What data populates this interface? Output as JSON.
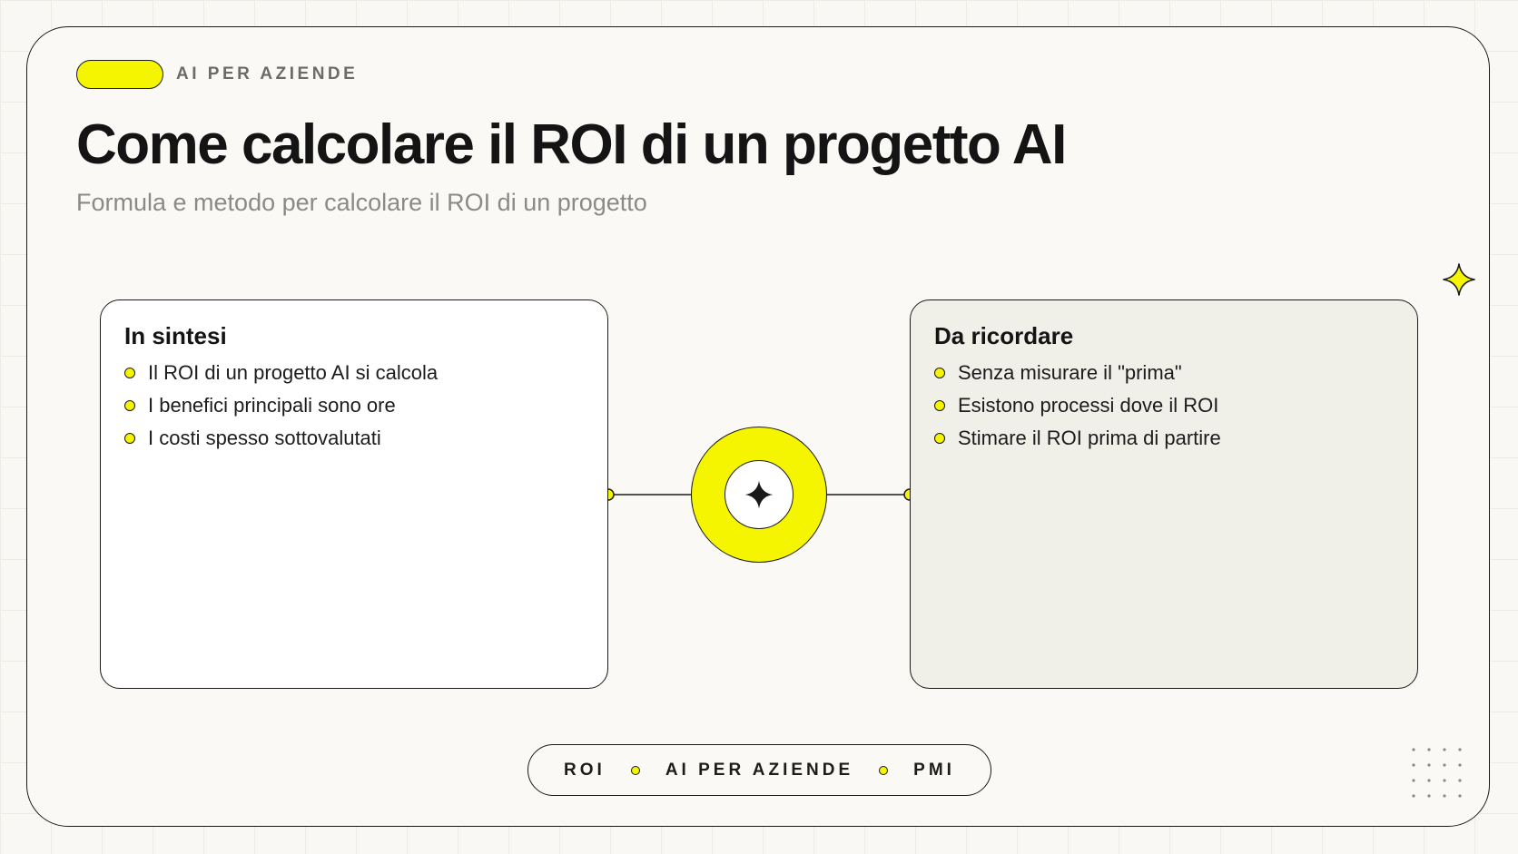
{
  "header": {
    "badge_label": "AI PER AZIENDE",
    "title": "Come calcolare il ROI di un progetto AI",
    "subtitle": "Formula e metodo per calcolare il ROI di un progetto"
  },
  "left_panel": {
    "title": "In sintesi",
    "items": [
      "Il ROI di un progetto AI si calcola",
      "I benefici principali sono ore",
      "I costi spesso sottovalutati"
    ]
  },
  "right_panel": {
    "title": "Da ricordare",
    "items": [
      "Senza misurare il \"prima\"",
      "Esistono processi dove il ROI",
      "Stimare il ROI prima di partire"
    ]
  },
  "tags": [
    "ROI",
    "AI PER AZIENDE",
    "PMI"
  ],
  "icons": {
    "hub": "four-point-star-icon",
    "corner": "sparkle-icon",
    "decoration": "dot-grid-icon"
  },
  "colors": {
    "accent": "#f5f500",
    "ink": "#1a1a1a",
    "muted_text": "#8a8a8a",
    "background": "#faf9f6",
    "right_panel_fill": "#f0efe8"
  }
}
